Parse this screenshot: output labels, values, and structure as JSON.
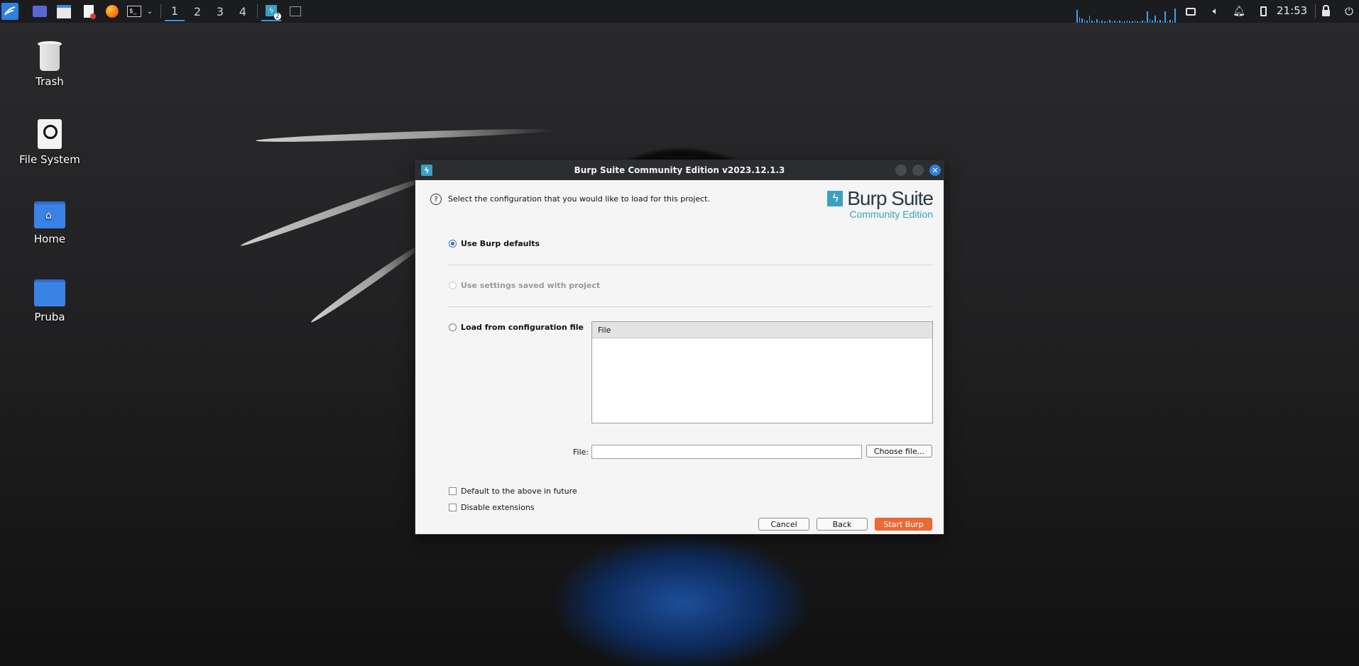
{
  "taskbar": {
    "workspaces": [
      "1",
      "2",
      "3",
      "4"
    ],
    "active_workspace": "1",
    "window_badge": "2",
    "clock": "21:53",
    "accent": "#3d8fe0"
  },
  "desktop": {
    "icons": [
      {
        "label": "Trash"
      },
      {
        "label": "File System"
      },
      {
        "label": "Home"
      },
      {
        "label": "Pruba"
      }
    ]
  },
  "dialog": {
    "title": "Burp Suite Community Edition v2023.12.1.3",
    "instruction": "Select the configuration that you would like to load for this project.",
    "logo_main": "Burp Suite",
    "logo_sub": "Community Edition",
    "options": {
      "defaults": "Use Burp defaults",
      "project": "Use settings saved with project",
      "config_file": "Load from configuration file"
    },
    "selected_option": "Use Burp defaults",
    "table_header": "File",
    "file_label": "File:",
    "file_value": "",
    "choose_file": "Choose file...",
    "default_future": "Default to the above in future",
    "disable_extensions": "Disable extensions",
    "cancel": "Cancel",
    "back": "Back",
    "start": "Start Burp",
    "brand_color": "#3aa2c0",
    "start_color": "#ee6a34"
  }
}
